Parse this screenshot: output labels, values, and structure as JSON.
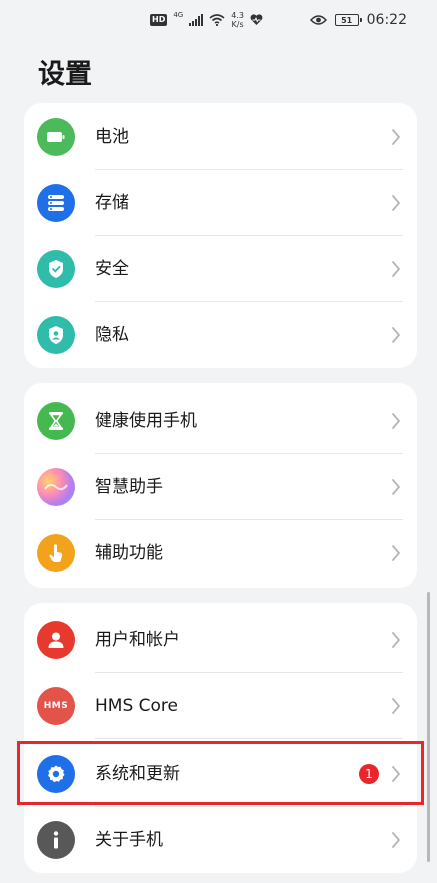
{
  "status_bar": {
    "hd": "HD",
    "net": "4G",
    "speed_value": "4.3",
    "speed_unit": "K/s",
    "battery": "51",
    "time": "06:22"
  },
  "page": {
    "title": "设置"
  },
  "groups": [
    {
      "items": [
        {
          "label": "电池",
          "icon": "battery-icon",
          "color": "#4cb95a"
        },
        {
          "label": "存储",
          "icon": "storage-icon",
          "color": "#1f6fe8"
        },
        {
          "label": "安全",
          "icon": "shield-icon",
          "color": "#2fbcaa"
        },
        {
          "label": "隐私",
          "icon": "privacy-icon",
          "color": "#2fbcaa"
        }
      ]
    },
    {
      "items": [
        {
          "label": "健康使用手机",
          "icon": "hourglass-icon",
          "color": "#45b84f"
        },
        {
          "label": "智慧助手",
          "icon": "assistant-icon",
          "color": "#c06ee0"
        },
        {
          "label": "辅助功能",
          "icon": "hand-icon",
          "color": "#f3a31b"
        }
      ]
    },
    {
      "items": [
        {
          "label": "用户和帐户",
          "icon": "user-icon",
          "color": "#e8392e"
        },
        {
          "label": "HMS Core",
          "icon": "hms-icon",
          "icon_text": "HMS",
          "color": "#e2534a"
        },
        {
          "label": "系统和更新",
          "icon": "gear-icon",
          "color": "#1f6fe8",
          "badge": "1"
        },
        {
          "label": "关于手机",
          "icon": "info-icon",
          "color": "#585858"
        }
      ]
    }
  ]
}
